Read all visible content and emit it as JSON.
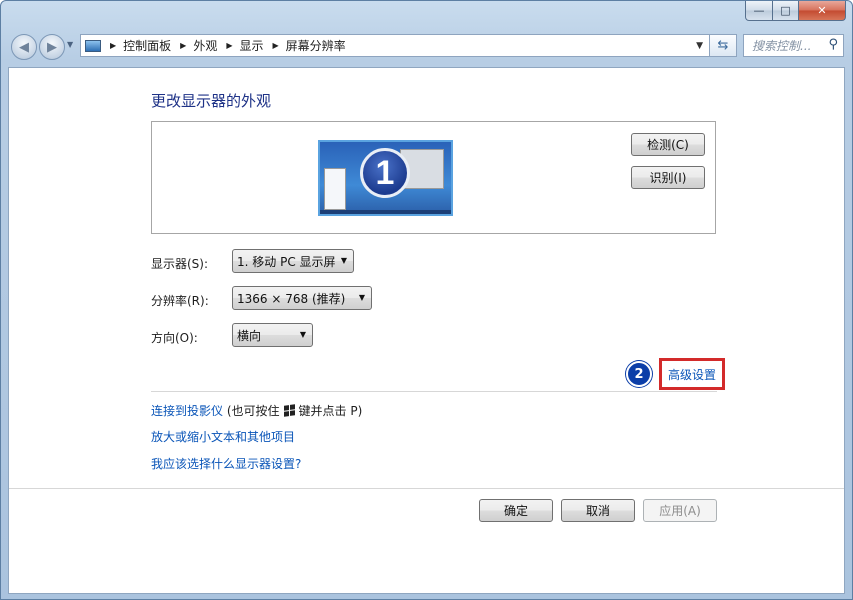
{
  "window": {
    "caption": {
      "minimize": "—",
      "maximize": "□",
      "close": "✕"
    }
  },
  "address_bar": {
    "breadcrumbs": [
      "控制面板",
      "外观",
      "显示",
      "屏幕分辨率"
    ],
    "search_placeholder": "搜索控制..."
  },
  "main": {
    "title": "更改显示器的外观",
    "monitor_number": "1",
    "detect_button": "检测(C)",
    "identify_button": "识别(I)",
    "display_label": "显示器(S):",
    "display_value": "1. 移动 PC 显示屏",
    "resolution_label": "分辨率(R):",
    "resolution_value": "1366 × 768 (推荐)",
    "orientation_label": "方向(O):",
    "orientation_value": "横向",
    "step_marker": "2",
    "advanced_link": "高级设置",
    "projector_link": "连接到投影仪",
    "projector_hint_prefix": "(也可按住",
    "projector_hint_suffix": "键并点击 P)",
    "text_size_link": "放大或缩小文本和其他项目",
    "which_settings_link": "我应该选择什么显示器设置?"
  },
  "footer": {
    "ok": "确定",
    "cancel": "取消",
    "apply": "应用(A)"
  },
  "colors": {
    "heading": "#1e3287",
    "link": "#0a55b8",
    "highlight_box": "#d32a2a",
    "step_marker": "#0b3ea8"
  }
}
